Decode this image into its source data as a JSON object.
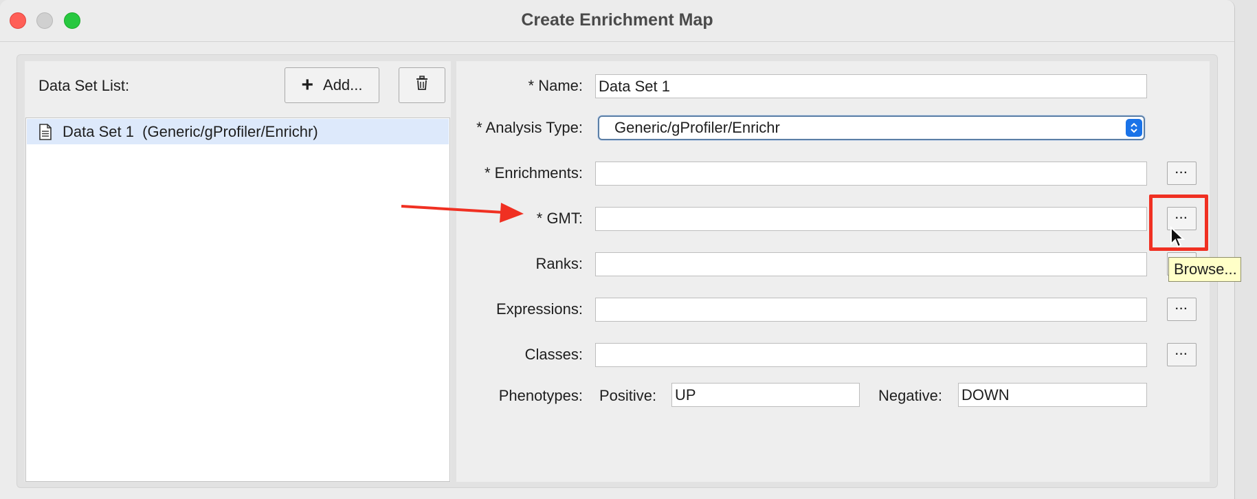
{
  "window": {
    "title": "Create Enrichment Map",
    "controls": [
      "close",
      "minimize",
      "maximize"
    ]
  },
  "dataset_list": {
    "label": "Data Set List:",
    "add_button": "Add...",
    "delete_icon": "trash-icon",
    "items": [
      {
        "icon": "document-icon",
        "label": "Data Set 1  (Generic/gProfiler/Enrichr)",
        "selected": true
      }
    ]
  },
  "form": {
    "name": {
      "label": "* Name:",
      "value": "Data Set 1"
    },
    "analysis_type": {
      "label": "* Analysis Type:",
      "value": "Generic/gProfiler/Enrichr"
    },
    "enrichments": {
      "label": "* Enrichments:",
      "value": "",
      "browse": "···"
    },
    "gmt": {
      "label": "* GMT:",
      "value": "",
      "browse": "···"
    },
    "ranks": {
      "label": "Ranks:",
      "value": "",
      "browse": "···"
    },
    "expressions": {
      "label": "Expressions:",
      "value": "",
      "browse": "···"
    },
    "classes": {
      "label": "Classes:",
      "value": "",
      "browse": "···"
    },
    "phenotypes": {
      "label": "Phenotypes:",
      "positive_label": "Positive:",
      "positive_value": "UP",
      "negative_label": "Negative:",
      "negative_value": "DOWN"
    }
  },
  "tooltip": "Browse...",
  "annotation_colors": {
    "highlight": "#f03022",
    "arrow": "#f03022",
    "accent": "#1a73e8"
  }
}
